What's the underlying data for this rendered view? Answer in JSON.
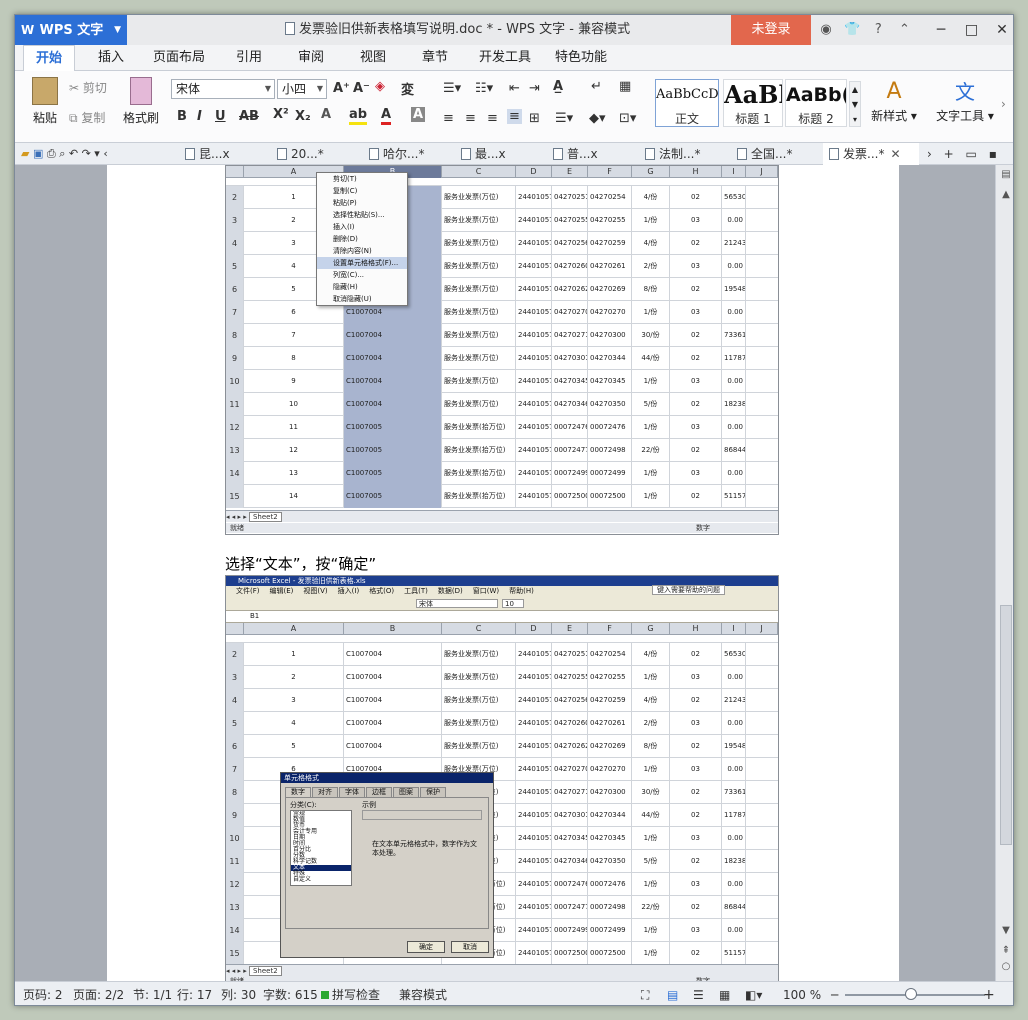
{
  "app": {
    "name": "WPS 文字",
    "doc_title": "发票验旧供新表格填写说明.doc * - WPS 文字 - 兼容模式",
    "login_label": "未登录",
    "top_icons": [
      "◉",
      "👕",
      "?",
      "⌃"
    ],
    "window_controls": [
      "─",
      "□",
      "✕"
    ]
  },
  "ribbon_tabs": [
    "开始",
    "插入",
    "页面布局",
    "引用",
    "审阅",
    "视图",
    "章节",
    "开发工具",
    "特色功能"
  ],
  "ribbon": {
    "paste": "粘贴",
    "cut": "剪切",
    "copy": "复制",
    "format_painter": "格式刷",
    "font_name": "宋体",
    "font_size": "小四",
    "styles": [
      {
        "preview": "AaBbCcD",
        "label": "正文"
      },
      {
        "preview": "AaBl",
        "label": "标题 1"
      },
      {
        "preview": "AaBb(",
        "label": "标题 2"
      }
    ],
    "new_style": "新样式",
    "text_tools": "文字工具"
  },
  "doc_tabs": [
    "昆...x",
    "20...*",
    "哈尔...*",
    "最...x",
    "普...x",
    "法制...*",
    "全国...*",
    "发票...*"
  ],
  "document": {
    "caption": "选择“文本”，按“确定”",
    "columns": [
      "A",
      "B",
      "C",
      "D",
      "E",
      "F",
      "G",
      "H",
      "I",
      "J"
    ],
    "row_headers": [
      "1",
      "2",
      "3",
      "4",
      "5",
      "6",
      "7",
      "8",
      "9",
      "10",
      "11",
      "12",
      "13",
      "14",
      "15"
    ],
    "rows": [
      [
        "1",
        "C1007004",
        "服务业发票(万位)",
        "244010570041",
        "04270251",
        "04270254",
        "4/份",
        "02",
        "56530.72"
      ],
      [
        "2",
        "C1007004",
        "服务业发票(万位)",
        "244010570041",
        "04270255",
        "04270255",
        "1/份",
        "03",
        "0.00"
      ],
      [
        "3",
        "C1007004",
        "服务业发票(万位)",
        "244010570041",
        "04270256",
        "04270259",
        "4/份",
        "02",
        "212432.57"
      ],
      [
        "4",
        "C1007004",
        "服务业发票(万位)",
        "244010570041",
        "04270260",
        "04270261",
        "2/份",
        "03",
        "0.00"
      ],
      [
        "5",
        "C1007004",
        "服务业发票(万位)",
        "244010570041",
        "04270262",
        "04270269",
        "8/份",
        "02",
        "195488.39"
      ],
      [
        "6",
        "C1007004",
        "服务业发票(万位)",
        "244010570041",
        "04270270",
        "04270270",
        "1/份",
        "03",
        "0.00"
      ],
      [
        "7",
        "C1007004",
        "服务业发票(万位)",
        "244010570041",
        "04270271",
        "04270300",
        "30/份",
        "02",
        "733614.70"
      ],
      [
        "8",
        "C1007004",
        "服务业发票(万位)",
        "244010570041",
        "04270301",
        "04270344",
        "44/份",
        "02",
        "1178705.58"
      ],
      [
        "9",
        "C1007004",
        "服务业发票(万位)",
        "244010570041",
        "04270345",
        "04270345",
        "1/份",
        "03",
        "0.00"
      ],
      [
        "10",
        "C1007004",
        "服务业发票(万位)",
        "244010570041",
        "04270346",
        "04270350",
        "5/份",
        "02",
        "182382.38"
      ],
      [
        "11",
        "C1007005",
        "服务业发票(拾万位)",
        "244010570051",
        "00072476",
        "00072476",
        "1/份",
        "03",
        "0.00"
      ],
      [
        "12",
        "C1007005",
        "服务业发票(拾万位)",
        "244010570051",
        "00072477",
        "00072498",
        "22/份",
        "02",
        "8684490.00"
      ],
      [
        "13",
        "C1007005",
        "服务业发票(拾万位)",
        "244010570051",
        "00072499",
        "00072499",
        "1/份",
        "03",
        "0.00"
      ],
      [
        "14",
        "C1007005",
        "服务业发票(拾万位)",
        "244010570051",
        "00072500",
        "00072500",
        "1/份",
        "02",
        "511579.31"
      ]
    ],
    "context_menu": [
      "剪切(T)",
      "复制(C)",
      "粘贴(P)",
      "选择性粘贴(S)...",
      "插入(I)",
      "删除(D)",
      "清除内容(N)",
      "设置单元格格式(F)...",
      "列宽(C)...",
      "隐藏(H)",
      "取消隐藏(U)"
    ],
    "sheet_tab": "Sheet2",
    "mini_status_left": "就绪",
    "mini_status_right": "数字",
    "excel_title": "Microsoft Excel - 发票验旧供新表格.xls",
    "excel_menu": [
      "文件(F)",
      "编辑(E)",
      "视图(V)",
      "插入(I)",
      "格式(O)",
      "工具(T)",
      "数据(D)",
      "窗口(W)",
      "帮助(H)"
    ],
    "excel_help_box": "键入需要帮助的问题",
    "name_box": "B1",
    "font_box": "宋体",
    "font_size_box": "10",
    "dialog_title": "单元格格式",
    "dialog_tabs": [
      "数字",
      "对齐",
      "字体",
      "边框",
      "图案",
      "保护"
    ],
    "dialog_category_label": "分类(C):",
    "dialog_sample_label": "示例",
    "dialog_categories": [
      "常规",
      "数值",
      "货币",
      "会计专用",
      "日期",
      "时间",
      "百分比",
      "分数",
      "科学记数",
      "文本",
      "特殊",
      "自定义"
    ],
    "dialog_selected": "文本",
    "dialog_desc": "在文本单元格格式中，数字作为文本处理。",
    "dialog_ok": "确定",
    "dialog_cancel": "取消"
  },
  "status": {
    "page_code": "页码: 2",
    "pages": "页面: 2/2",
    "section": "节: 1/1",
    "line": "行: 17",
    "col": "列: 30",
    "words": "字数: 615",
    "spell": "拼写检查",
    "compat": "兼容模式",
    "zoom": "100 %"
  },
  "colors": {
    "accent": "#2c6fd6",
    "login": "#e2674d",
    "selection": "#a8b4cf"
  }
}
